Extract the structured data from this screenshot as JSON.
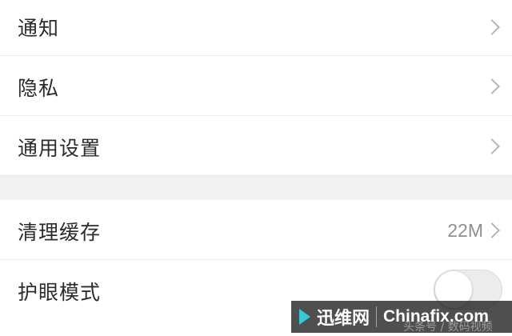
{
  "settings_group_1": {
    "items": [
      {
        "label": "通知",
        "icon": "chevron-right-icon"
      },
      {
        "label": "隐私",
        "icon": "chevron-right-icon"
      },
      {
        "label": "通用设置",
        "icon": "chevron-right-icon"
      }
    ]
  },
  "settings_group_2": {
    "clear_cache": {
      "label": "清理缓存",
      "value": "22M",
      "icon": "chevron-right-icon"
    },
    "eye_protection": {
      "label": "护眼模式",
      "toggle_on": false
    }
  },
  "watermark": {
    "brand_cn": "迅维网",
    "brand_en": "Chinafix.com",
    "sub": "头条号 / 数码视频"
  },
  "colors": {
    "background": "#ffffff",
    "section_gap": "#f2f2f2",
    "text": "#2b2b2b",
    "value_text": "#8e8e8e",
    "chevron": "#b5b5b5",
    "watermark_accent": "#38c8d6"
  }
}
